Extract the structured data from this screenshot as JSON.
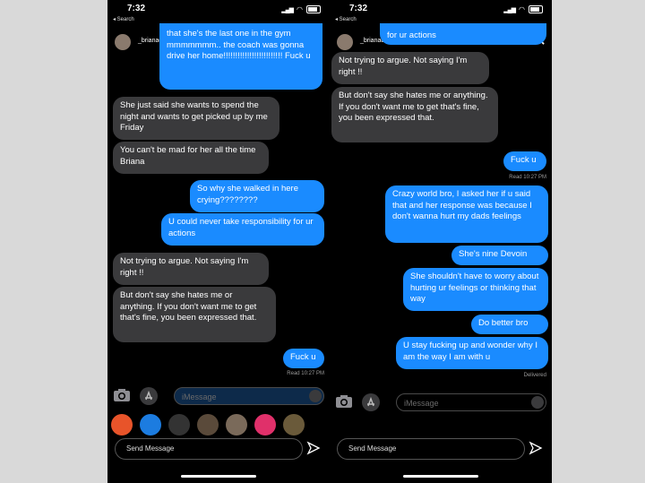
{
  "status": {
    "time": "7:32",
    "back_label": "◂ Search"
  },
  "story": {
    "username": "_brianadurkin"
  },
  "left": {
    "top_bubble": "that she's the last one in the gym mmmmmmm.. the coach was gonna drive her home!!!!!!!!!!!!!!!!!!!!!!!!! Fuck u",
    "messages": [
      "She just said she wants to spend the night and wants to get picked up by me Friday",
      "You can't be mad for her all the time Briana",
      "So why she walked in here crying????????",
      "U could never take responsibility for ur actions",
      "Not trying to argue. Not saying I'm right !!",
      "But don't say she hates me or anything. If you don't want me to get that's fine, you been expressed that.",
      "Fuck u"
    ],
    "receipt": "Read 10:27 PM"
  },
  "right": {
    "top_bubble": "for ur actions",
    "messages": [
      "Not trying to argue. Not saying I'm right !!",
      "But don't say she hates me or anything. If you don't want me to get that's fine, you been expressed that.",
      "Fuck u",
      "Crazy world bro, I asked her if u said that and her response was because I don't wanna hurt my dads feelings",
      "She's nine Devoin",
      "She shouldn't have to worry about hurting ur feelings or thinking that way",
      "Do better bro",
      "U stay fucking up and wonder why I am the way I am with u"
    ],
    "receipt": "Read 10:27 PM",
    "delivered": "Delivered"
  },
  "composer": {
    "placeholder": "iMessage",
    "send_message": "Send Message"
  },
  "colors": {
    "blue_bubble": "#1a8bff",
    "gray_bubble": "#3a3a3c",
    "background": "#000000"
  }
}
